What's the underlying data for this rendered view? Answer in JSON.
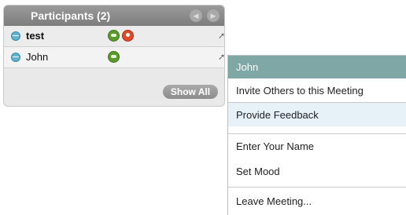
{
  "participants_panel": {
    "title": "Participants (2)",
    "nav": {
      "prev_icon": "chevron-left-icon",
      "next_icon": "chevron-right-icon"
    },
    "rows": [
      {
        "name": "test",
        "bold": true,
        "icons": [
          "status-icon",
          "chat-icon",
          "presenter-icon",
          "pin-icon"
        ]
      },
      {
        "name": "John",
        "bold": false,
        "icons": [
          "status-icon",
          "chat-icon",
          "pin-icon"
        ]
      }
    ],
    "show_all_label": "Show All"
  },
  "context_menu": {
    "header": "John",
    "items": [
      {
        "label": "Invite Others to this Meeting"
      },
      {
        "label": "Provide Feedback",
        "highlighted": true
      },
      {
        "label": "Enter Your Name"
      },
      {
        "label": "Set Mood",
        "has_submenu": true,
        "submenu_glyph": "›"
      },
      {
        "label": "Leave Meeting..."
      }
    ]
  },
  "glyphs": {
    "prev": "◀",
    "next": "▶",
    "pin": "➚"
  },
  "colors": {
    "menu_header": "#7fa7a6",
    "highlight": "#e7f1f8"
  }
}
